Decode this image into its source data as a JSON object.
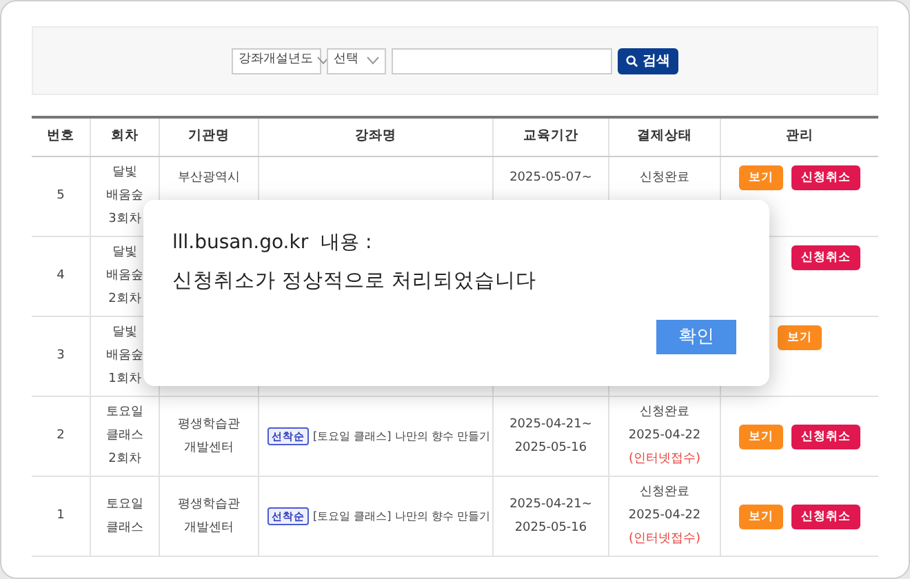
{
  "search": {
    "selects": [
      "강좌개설년도",
      "선택"
    ],
    "button": "검색"
  },
  "table": {
    "columns": [
      "번호",
      "회차",
      "기관명",
      "강좌명",
      "교육기간",
      "결제상태",
      "관리"
    ],
    "rows": [
      {
        "number": "5",
        "round": [
          "달빛",
          "배움숲",
          "3회차"
        ],
        "org": [
          "부산광역시"
        ],
        "period": [
          "2025-05-07~"
        ],
        "status": [
          {
            "text": "신청완료",
            "kind": "normal"
          }
        ],
        "buttons": [
          {
            "label": "보기",
            "kind": "view"
          },
          {
            "label": "신청취소",
            "kind": "cancel"
          }
        ]
      },
      {
        "number": "4",
        "round": [
          "달빛",
          "배움숲",
          "2회차"
        ],
        "buttons": [
          {
            "label": "신청취소",
            "kind": "cancel"
          }
        ]
      },
      {
        "number": "3",
        "round": [
          "달빛",
          "배움숲",
          "1회차"
        ],
        "buttons": [
          {
            "label": "보기",
            "kind": "view"
          }
        ]
      },
      {
        "number": "2",
        "round": [
          "토요일",
          "클래스",
          "2회차"
        ],
        "org": [
          "평생학습관",
          "개발센터"
        ],
        "course": {
          "tag": "선착순",
          "title": "[토요일 클래스] 나만의 향수 만들기"
        },
        "period": [
          "2025-04-21~",
          "2025-05-16"
        ],
        "status": [
          {
            "text": "신청완료",
            "kind": "normal"
          },
          {
            "text": "2025-04-22",
            "kind": "normal"
          },
          {
            "text": "(인터넷접수)",
            "kind": "note"
          }
        ],
        "buttons": [
          {
            "label": "보기",
            "kind": "view"
          },
          {
            "label": "신청취소",
            "kind": "cancel"
          }
        ]
      },
      {
        "number": "1",
        "round": [
          "토요일",
          "클래스"
        ],
        "org": [
          "평생학습관",
          "개발센터"
        ],
        "course": {
          "tag": "선착순",
          "title": "[토요일 클래스] 나만의 향수 만들기"
        },
        "period": [
          "2025-04-21~",
          "2025-05-16"
        ],
        "status": [
          {
            "text": "신청완료",
            "kind": "normal"
          },
          {
            "text": "2025-04-22",
            "kind": "normal"
          },
          {
            "text": "(인터넷접수)",
            "kind": "note"
          }
        ],
        "buttons": [
          {
            "label": "보기",
            "kind": "view"
          },
          {
            "label": "신청취소",
            "kind": "cancel"
          }
        ]
      }
    ]
  },
  "dialog": {
    "title": "lll.busan.go.kr  내용 :",
    "message": "신청취소가 정상적으로 처리되었습니다",
    "button": "확인"
  }
}
